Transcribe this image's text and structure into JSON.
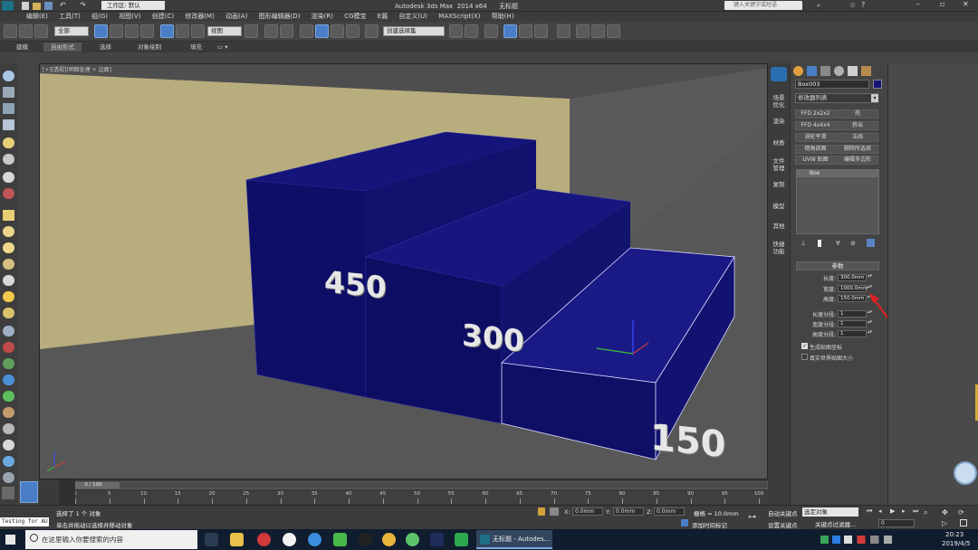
{
  "window": {
    "title": "Autodesk 3ds Max  2014 x64      无标题",
    "workspace_label": "工作区: 默认",
    "search_placeholder": "键入关键字或短语"
  },
  "menu": [
    "编辑(E)",
    "工具(T)",
    "组(G)",
    "视图(V)",
    "创建(C)",
    "修改器(M)",
    "动画(A)",
    "图形编辑器(D)",
    "渲染(R)",
    "CG模宝",
    "E酱",
    "自定义(U)",
    "MAXScript(X)",
    "帮助(H)"
  ],
  "toolbar": {
    "selection_filter": "全部",
    "ref_coord": "视图",
    "named_selection": "创建选择集"
  },
  "ribbon": [
    "建模",
    "自由形式",
    "选择",
    "对象绘制",
    "填充"
  ],
  "viewport": {
    "label": "[+][透视][明暗处理 + 边面]",
    "step_labels": [
      "450",
      "300",
      "150"
    ]
  },
  "command_tabs": [
    "场景优化",
    "渲染",
    "材质",
    "文件管理",
    "复制",
    "模型",
    "其他",
    "快捷功能"
  ],
  "modify_panel": {
    "object_name": "Box003",
    "object_color": "#14147a",
    "modifier_list": "修改器列表",
    "modifier_buttons": [
      "FFD 2x2x2",
      "壳",
      "FFD 4x4x4",
      "挤出",
      "涡轮平滑",
      "法线",
      "倒角剖面",
      "删除所选择",
      "UVW 贴图",
      "编辑多边形"
    ],
    "stack_item": "Box",
    "rollout_title": "参数",
    "params": [
      {
        "label": "长度:",
        "value": "300.0mm"
      },
      {
        "label": "宽度:",
        "value": "1000.0mm"
      },
      {
        "label": "高度:",
        "value": "150.0mm"
      }
    ],
    "segments": [
      {
        "label": "长度分段:",
        "value": "1"
      },
      {
        "label": "宽度分段:",
        "value": "1"
      },
      {
        "label": "高度分段:",
        "value": "1"
      }
    ],
    "checks": [
      {
        "label": "生成贴图坐标",
        "checked": true
      },
      {
        "label": "真实世界贴图大小",
        "checked": false
      }
    ]
  },
  "timeline": {
    "frame": "0 / 100",
    "ticks": [
      "0",
      "5",
      "10",
      "15",
      "20",
      "25",
      "30",
      "35",
      "40",
      "45",
      "50",
      "55",
      "60",
      "65",
      "70",
      "75",
      "80",
      "85",
      "90",
      "95",
      "100"
    ]
  },
  "status": {
    "maxscript": "Testing for AU",
    "line1": "选择了 1 个 对象",
    "line2": "单击并拖动以选择并移动对象",
    "x": "0.0mm",
    "y": "0.0mm",
    "z": "0.0mm",
    "grid": "栅格 = 10.0mm",
    "add_time_tag": "添加时间标记",
    "autokey": "自动关键点",
    "setkey": "设置关键点",
    "selected": "选定对象",
    "key_filters": "关键点过滤器...",
    "frame_field": "0"
  },
  "taskbar": {
    "search_text": "在这里输入你要搜索的内容",
    "active_app": "无标题 - Autodes...",
    "time": "20:23",
    "date": "2019/4/5"
  }
}
